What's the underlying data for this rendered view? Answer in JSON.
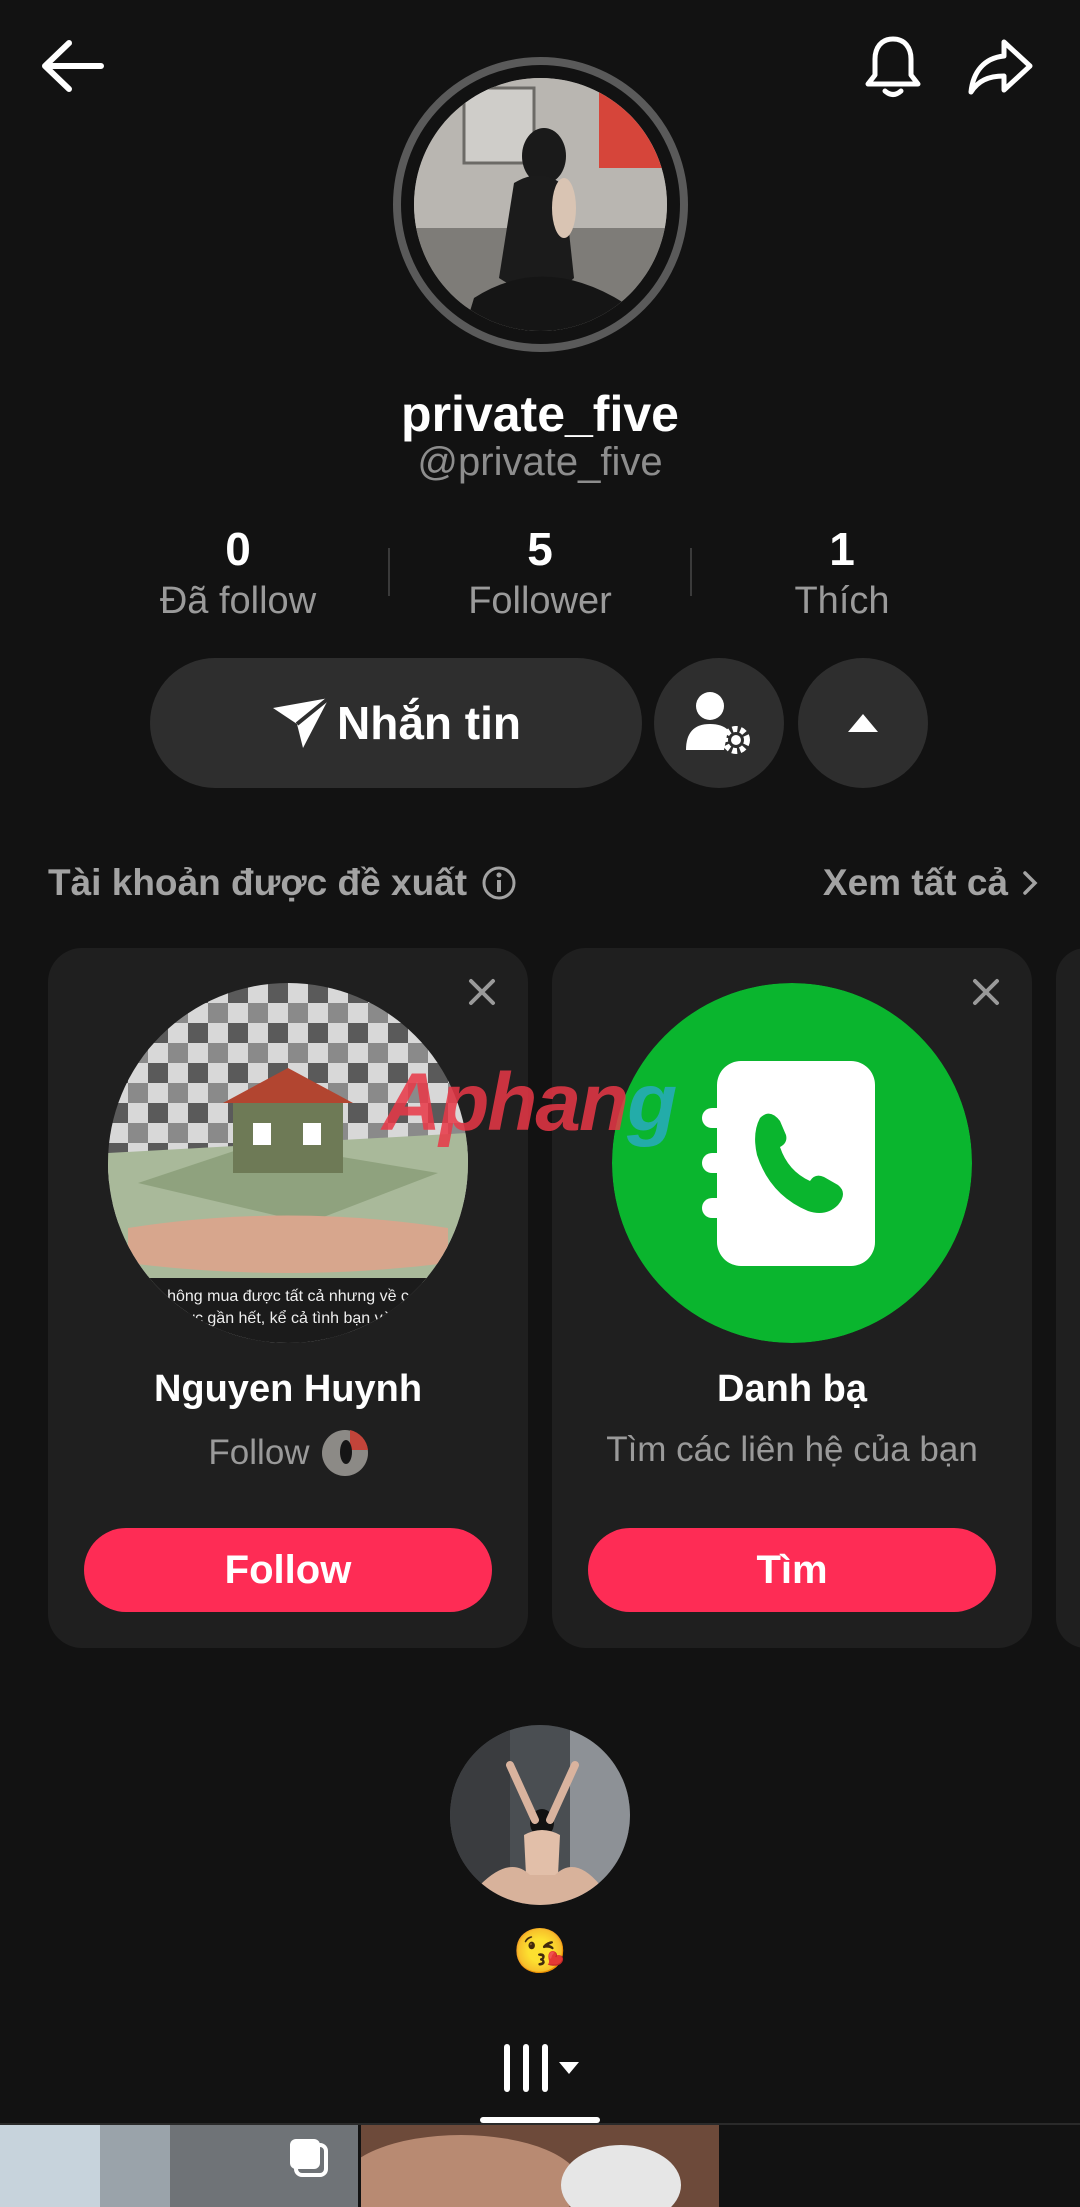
{
  "header": {
    "back_icon": "arrow-left-icon",
    "bell_icon": "bell-icon",
    "share_icon": "share-icon"
  },
  "profile": {
    "display_name": "private_five",
    "handle": "@private_five",
    "stats": [
      {
        "value": "0",
        "label": "Đã follow"
      },
      {
        "value": "5",
        "label": "Follower"
      },
      {
        "value": "1",
        "label": "Thích"
      }
    ],
    "message_button": "Nhắn tin"
  },
  "suggestions": {
    "title": "Tài khoản được đề xuất",
    "see_all": "Xem tất cả",
    "cards": [
      {
        "name": "Nguyen Huynh",
        "subtitle": "Follow",
        "button": "Follow",
        "avatar_caption_1": "hông mua được tất cả nhưng về c",
        "avatar_caption_2": "ợc gần hết, kể cả tình bạn và"
      },
      {
        "name": "Danh bạ",
        "subtitle": "Tìm các liên hệ của bạn",
        "button": "Tìm"
      }
    ]
  },
  "story": {
    "emoji": "😘"
  },
  "watermark": {
    "part1": "Aphan",
    "part2": "g"
  },
  "colors": {
    "background": "#121212",
    "accent": "#fe2c55",
    "contacts_green": "#0ab52e",
    "button_bg": "#2e2e2e"
  }
}
